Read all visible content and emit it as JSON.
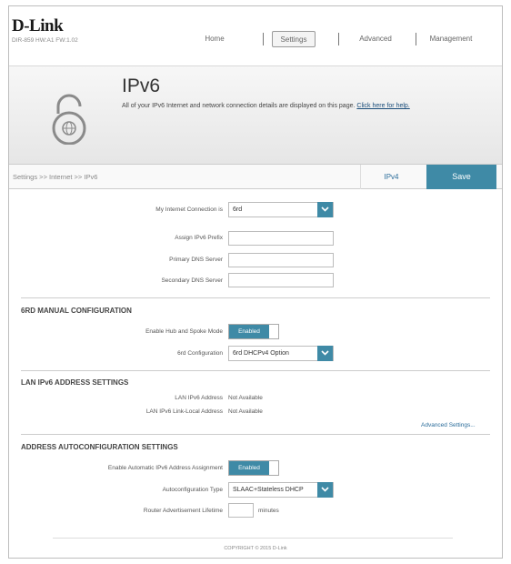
{
  "header": {
    "logo": "D-Link",
    "device_info": "DIR-859 HW:A1 FW:1.02",
    "nav": [
      {
        "label": "Home"
      },
      {
        "label": "Settings"
      },
      {
        "label": "Advanced"
      },
      {
        "label": "Management"
      }
    ]
  },
  "banner": {
    "title": "IPv6",
    "description": "All of your IPv6 Internet and network connection details are displayed on this page.",
    "help_link": "Click here for help."
  },
  "subbar": {
    "breadcrumb": "Settings >> Internet >> IPv6",
    "ipv4_label": "IPv4",
    "save_label": "Save"
  },
  "connection": {
    "type_label": "My Internet Connection is",
    "type_value": "6rd",
    "prefix_label": "Assign IPv6 Prefix",
    "primary_dns_label": "Primary DNS Server",
    "secondary_dns_label": "Secondary DNS Server"
  },
  "sixrd": {
    "title": "6RD MANUAL CONFIGURATION",
    "hub_label": "Enable Hub and Spoke Mode",
    "hub_state": "Enabled",
    "config_label": "6rd Configuration",
    "config_value": "6rd DHCPv4 Option"
  },
  "lan": {
    "title": "LAN IPv6 ADDRESS SETTINGS",
    "addr_label": "LAN IPv6 Address",
    "addr_value": "Not Available",
    "ll_label": "LAN IPv6 Link-Local Address",
    "ll_value": "Not Available",
    "advanced_link": "Advanced Settings..."
  },
  "autoconf": {
    "title": "ADDRESS AUTOCONFIGURATION SETTINGS",
    "enable_label": "Enable Automatic IPv6 Address Assignment",
    "enable_state": "Enabled",
    "type_label": "Autoconfiguration Type",
    "type_value": "SLAAC+Stateless DHCP",
    "lifetime_label": "Router Advertisement Lifetime",
    "lifetime_unit": "minutes"
  },
  "footer": {
    "copyright": "COPYRIGHT © 2015 D-Link"
  },
  "colors": {
    "accent": "#3f8aa6",
    "link": "#2a6c9a"
  }
}
